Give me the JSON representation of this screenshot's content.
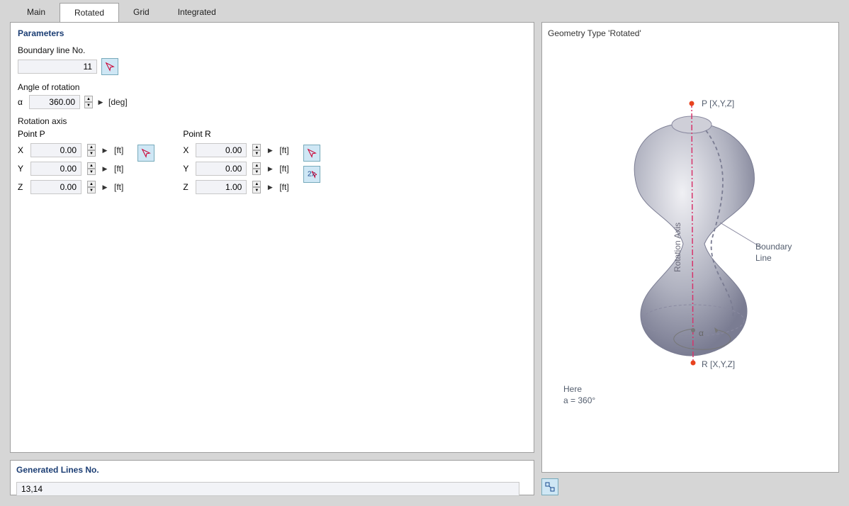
{
  "tabs": {
    "main": "Main",
    "rotated": "Rotated",
    "grid": "Grid",
    "integrated": "Integrated"
  },
  "parameters": {
    "title": "Parameters",
    "boundary_label": "Boundary line No.",
    "boundary_value": "11",
    "angle_label": "Angle of rotation",
    "alpha_symbol": "α",
    "alpha_value": "360.00",
    "alpha_unit": "[deg]",
    "axis_label": "Rotation axis",
    "point_p": "Point P",
    "point_r": "Point R",
    "x": "X",
    "y": "Y",
    "z": "Z",
    "p": {
      "x": "0.00",
      "y": "0.00",
      "z": "0.00"
    },
    "r": {
      "x": "0.00",
      "y": "0.00",
      "z": "1.00"
    },
    "ft": "[ft]"
  },
  "generated": {
    "title": "Generated Lines No.",
    "value": "13,14"
  },
  "preview": {
    "title": "Geometry Type 'Rotated'",
    "p_label": "P [X,Y,Z]",
    "r_label": "R [X,Y,Z]",
    "axis_label": "Rotation Axis",
    "boundary_label": "Boundary",
    "line_label": "Line",
    "alpha_sym": "α",
    "annot1": "Here",
    "annot2": "a = 360°"
  }
}
